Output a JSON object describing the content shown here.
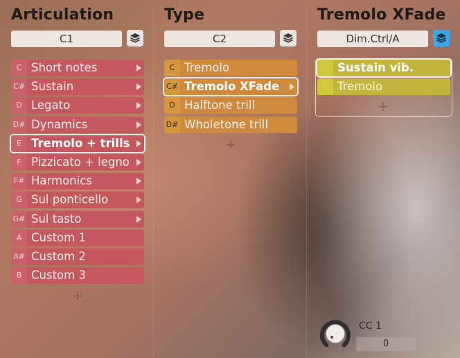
{
  "columns": {
    "articulation": {
      "title": "Articulation",
      "selector_value": "C1",
      "items": [
        {
          "key": "C",
          "label": "Short notes",
          "has_arrow": true
        },
        {
          "key": "C#",
          "label": "Sustain",
          "has_arrow": true
        },
        {
          "key": "D",
          "label": "Legato",
          "has_arrow": true
        },
        {
          "key": "D#",
          "label": "Dynamics",
          "has_arrow": true
        },
        {
          "key": "E",
          "label": "Tremolo + trills",
          "has_arrow": true,
          "selected": true
        },
        {
          "key": "F",
          "label": "Pizzicato + legno",
          "has_arrow": true
        },
        {
          "key": "F#",
          "label": "Harmonics",
          "has_arrow": true
        },
        {
          "key": "G",
          "label": "Sul ponticello",
          "has_arrow": true
        },
        {
          "key": "G#",
          "label": "Sul tasto",
          "has_arrow": true
        },
        {
          "key": "A",
          "label": "Custom 1",
          "has_arrow": false
        },
        {
          "key": "A#",
          "label": "Custom 2",
          "has_arrow": false
        },
        {
          "key": "B",
          "label": "Custom 3",
          "has_arrow": false
        }
      ],
      "add_label": "+"
    },
    "type": {
      "title": "Type",
      "selector_value": "C2",
      "items": [
        {
          "key": "C",
          "label": "Tremolo",
          "has_arrow": false
        },
        {
          "key": "C#",
          "label": "Tremolo XFade",
          "has_arrow": true,
          "selected": true
        },
        {
          "key": "D",
          "label": "Halftone trill",
          "has_arrow": false
        },
        {
          "key": "D#",
          "label": "Wholetone trill",
          "has_arrow": false
        }
      ],
      "add_label": "+"
    },
    "xfade": {
      "title": "Tremolo XFade",
      "selector_value": "Dim.Ctrl/A",
      "items": [
        {
          "label": "Sustain vib.",
          "selected": true
        },
        {
          "label": "Tremolo",
          "selected": false
        }
      ],
      "add_label": "+"
    }
  },
  "controller": {
    "label": "CC 1",
    "value": "0"
  },
  "colors": {
    "articulation_red": "#c5585f",
    "type_orange": "#cf8a3d",
    "xfade_yellow": "#c1b53e",
    "layers_active": "#38a8e8"
  },
  "icons": {
    "layers": "layers-icon",
    "arrow": "chevron-right-icon",
    "knob": "knob-icon"
  }
}
